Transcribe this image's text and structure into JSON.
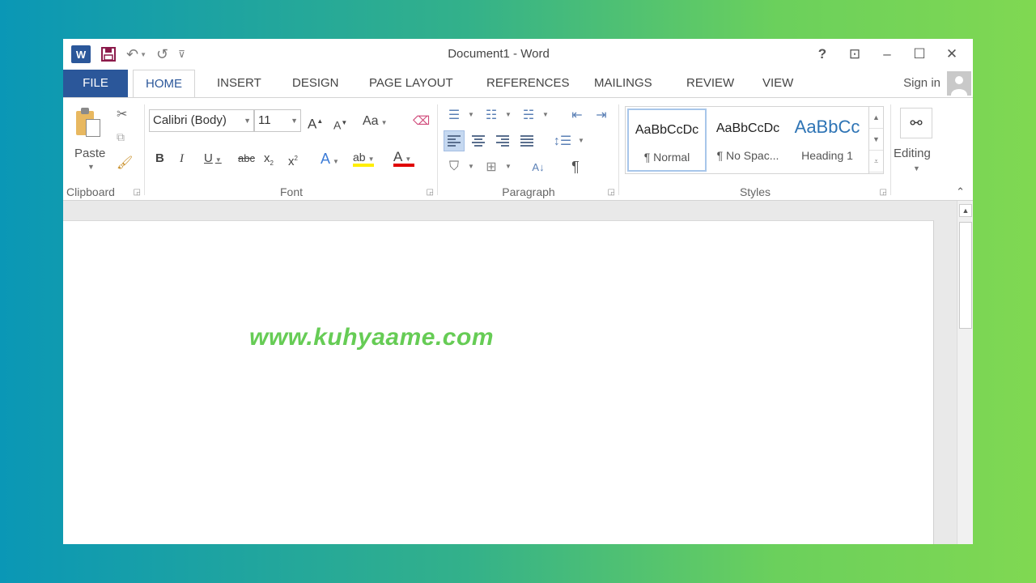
{
  "window": {
    "title": "Document1 - Word",
    "controls": {
      "help": "?",
      "ribbon_options": "⊡",
      "minimize": "–",
      "maximize": "☐",
      "close": "✕"
    }
  },
  "qat": {
    "logo": "W",
    "save": "💾",
    "undo": "↶",
    "redo": "↺",
    "customize": "⩡"
  },
  "tabs": {
    "file": "FILE",
    "items": [
      "HOME",
      "INSERT",
      "DESIGN",
      "PAGE LAYOUT",
      "REFERENCES",
      "MAILINGS",
      "REVIEW",
      "VIEW"
    ],
    "sign_in": "Sign in"
  },
  "ribbon": {
    "clipboard": {
      "label": "Clipboard",
      "paste": "Paste"
    },
    "font": {
      "label": "Font",
      "family": "Calibri (Body)",
      "size": "11",
      "grow": "A",
      "shrink": "A",
      "case": "Aa",
      "bold": "B",
      "italic": "I",
      "underline": "U",
      "strike": "abc",
      "subscript": "x",
      "superscript": "x",
      "effects": "A",
      "highlight": "ab",
      "font_color": "A",
      "highlight_color": "#ffee00",
      "font_color_value": "#e00000"
    },
    "paragraph": {
      "label": "Paragraph",
      "pilcrow": "¶",
      "sort": "A↓"
    },
    "styles": {
      "label": "Styles",
      "items": [
        {
          "sample": "AaBbCcDc",
          "name": "¶ Normal"
        },
        {
          "sample": "AaBbCcDc",
          "name": "¶ No Spac..."
        },
        {
          "sample": "AaBbCc",
          "name": "Heading 1"
        }
      ]
    },
    "editing": {
      "label": "Editing"
    }
  },
  "document": {
    "text": "www.kuhyaame.com"
  }
}
